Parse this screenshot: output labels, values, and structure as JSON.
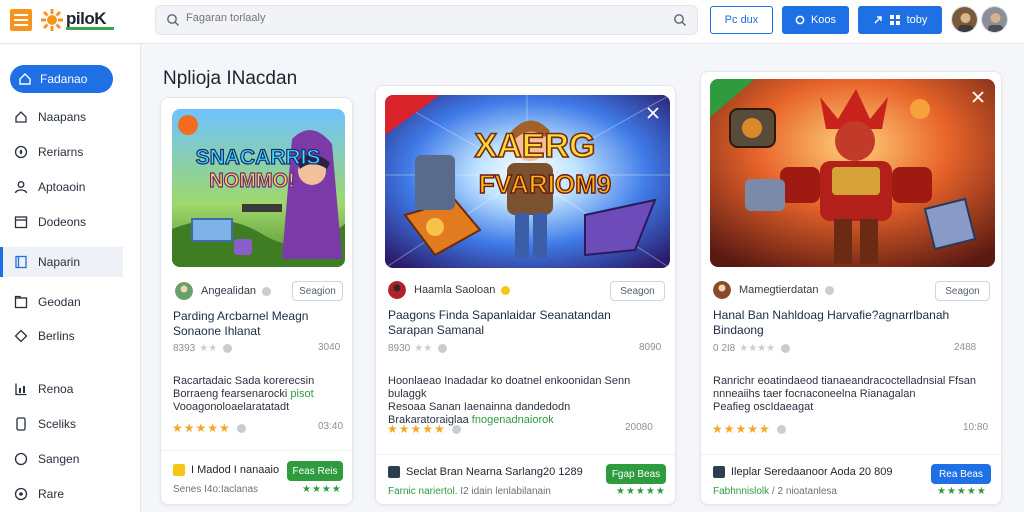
{
  "header": {
    "logo_text": "piloK",
    "search_placeholder": "Fagaran torlaaly",
    "btn_outline": "Pc dux",
    "btn_blue1": "Koos",
    "btn_blue2": "toby"
  },
  "sidebar": {
    "items": [
      {
        "label": "Fadanao",
        "icon": "home-icon"
      },
      {
        "label": "Naapans",
        "icon": "house-icon"
      },
      {
        "label": "Reriarns",
        "icon": "compass-icon"
      },
      {
        "label": "Aptoaoin",
        "icon": "user-icon"
      },
      {
        "label": "Dodeons",
        "icon": "calendar-icon"
      },
      {
        "label": "Naparin",
        "icon": "book-icon"
      },
      {
        "label": "Geodan",
        "icon": "folder-icon"
      },
      {
        "label": "Berlins",
        "icon": "diamond-icon"
      },
      {
        "label": "Renoa",
        "icon": "chart-icon"
      },
      {
        "label": "Sceliks",
        "icon": "device-icon"
      },
      {
        "label": "Sangen",
        "icon": "chat-icon"
      },
      {
        "label": "Rare",
        "icon": "settings-icon"
      }
    ]
  },
  "main": {
    "page_title": "Nplioja INacdan",
    "cards": [
      {
        "thumb_text_1": "SNACARRIS",
        "thumb_text_2": "NOMMO!",
        "user": "Angealidan",
        "follow": "Seagion",
        "title_1": "Parding Arcbarnel Meagn",
        "title_2": "Sonaone Ihlanat",
        "meta_left": "8393",
        "meta_right": "3040",
        "desc_1": "Racartadaic Sada korerecsin",
        "desc_2a": "Borraeng fearsenarocki ",
        "desc_2b": "pisot",
        "desc_3": "Vooagonoloaelaratatadt",
        "stars": "★★★★★",
        "stars_right": "03:40",
        "foot_title": "I Madod I nanaaio",
        "foot_sub": "Senes I4o:Iaclanas",
        "get_btn": "Feas Reis",
        "foot_stars": "★★★★"
      },
      {
        "thumb_text_1": "XAERG",
        "thumb_text_2": "FVARIOM9",
        "user": "Haamla Saoloan",
        "follow": "Seagon",
        "title_1": "Paagons Finda Sapanlaidar Seanatandan",
        "title_2": "Sarapan Samanal",
        "meta_left": "8930",
        "meta_right": "8090",
        "desc_1": "Hoonlaeao Inadadar ko doatnel enkoonidan Senn bulaggk",
        "desc_2": "Resoaa Sanan Iaenainna dandedodn",
        "desc_3a": "Brakaratoraiglaa ",
        "desc_3b": "fnogenadnaiorok",
        "stars": "★★★★★",
        "stars_right": "20080",
        "foot_title": "Seclat Bran Nearna Sarlang20 1289",
        "foot_sub_a": "Farnic nariertol.",
        "foot_sub_b": " I2 idain lenlabilanain",
        "get_btn": "Fgap Beas",
        "foot_stars": "★★★★★"
      },
      {
        "thumb_text_1": "",
        "thumb_text_2": "",
        "user": "Mamegtierdatan",
        "follow": "Seagon",
        "title_1": "Hanal Ban Nahldoag Harvafie?agnarrlbanah",
        "title_2": "Bindaong",
        "meta_left": "0 2I8",
        "meta_right": "2488",
        "desc_1": "Ranrichr eoatindaeod tianaeandracoctelladnsial Ffsan",
        "desc_2": "nnneaiihs taer focnaconeelna Rianagalan",
        "desc_3": "Peafieg oscIdaeagat",
        "stars": "★★★★★",
        "stars_right": "10:80",
        "foot_title": "Ileplar Seredaanoor Aoda 20 809",
        "foot_sub_a": "Fabhnnislolk",
        "foot_sub_b": " / 2 nioatanlesa",
        "get_btn": "Rea Beas",
        "foot_stars": "★★★★★"
      }
    ]
  },
  "colors": {
    "accent": "#1f6fe5",
    "green": "#2e9b3f",
    "star": "#f5a623"
  }
}
